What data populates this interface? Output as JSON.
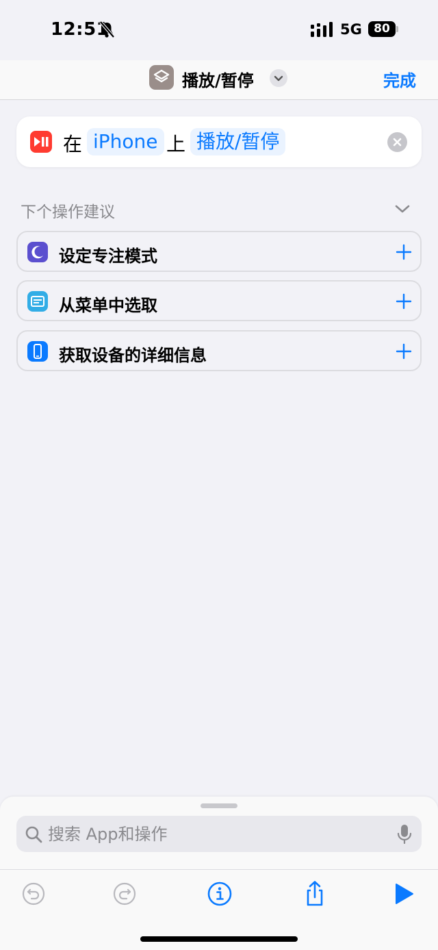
{
  "status_bar": {
    "time": "12:51",
    "network": "5G",
    "battery": "80"
  },
  "nav": {
    "title": "播放/暂停",
    "done_label": "完成"
  },
  "action": {
    "prefix": "在",
    "device_token": "iPhone",
    "middle": "上",
    "action_token": "播放/暂停"
  },
  "suggestions": {
    "header": "下个操作建议",
    "items": [
      {
        "label": "设定专注模式",
        "icon": "moon-icon",
        "color": "#5b4fcf"
      },
      {
        "label": "从菜单中选取",
        "icon": "menu-icon",
        "color": "#32ade6"
      },
      {
        "label": "获取设备的详细信息",
        "icon": "phone-icon",
        "color": "#0a7aff"
      }
    ]
  },
  "search": {
    "placeholder": "搜索 App和操作"
  },
  "colors": {
    "accent": "#0a7aff",
    "action_icon": "#ff3b30",
    "shortcut_icon": "#9a8e8a"
  }
}
